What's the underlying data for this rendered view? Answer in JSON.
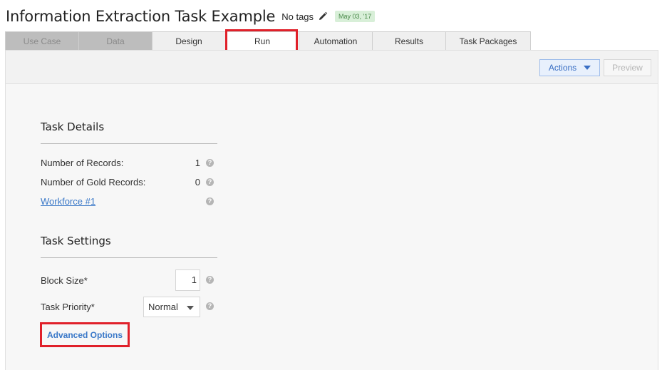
{
  "header": {
    "title": "Information Extraction Task Example",
    "tags_label": "No tags",
    "date": "May 03, '17"
  },
  "tabs": [
    {
      "label": "Use Case",
      "state": "disabled"
    },
    {
      "label": "Data",
      "state": "disabled"
    },
    {
      "label": "Design",
      "state": "normal"
    },
    {
      "label": "Run",
      "state": "active"
    },
    {
      "label": "Automation",
      "state": "normal"
    },
    {
      "label": "Results",
      "state": "normal"
    },
    {
      "label": "Task Packages",
      "state": "normal"
    }
  ],
  "toolbar": {
    "actions_label": "Actions",
    "preview_label": "Preview"
  },
  "task_details": {
    "title": "Task Details",
    "records_label": "Number of Records:",
    "records_value": "1",
    "gold_label": "Number of Gold Records:",
    "gold_value": "0",
    "workforce_link": "Workforce #1"
  },
  "task_settings": {
    "title": "Task Settings",
    "block_size_label": "Block Size*",
    "block_size_value": "1",
    "priority_label": "Task Priority*",
    "priority_value": "Normal",
    "advanced_options_label": "Advanced Options"
  },
  "colors": {
    "accent_blue": "#3a78c8",
    "highlight_red": "#e0202a",
    "date_badge_bg": "#d8efd8"
  },
  "icons": {
    "edit": "pencil-icon",
    "help": "question-circle-icon",
    "dropdown": "caret-down-icon"
  }
}
